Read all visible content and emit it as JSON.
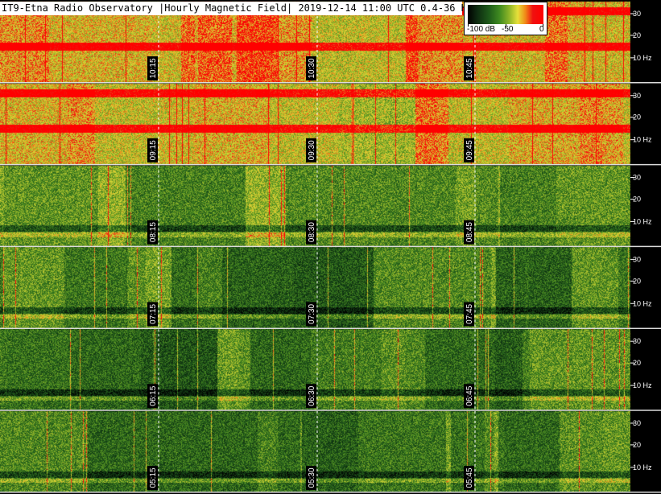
{
  "chart_data": {
    "type": "heatmap",
    "title": "IT9-Etna Radio Observatory |Hourly Magnetic Field| 2019-12-14 11:00 UTC 0.4-36 Hz",
    "colorbar": {
      "labels": [
        "-100 dB",
        "-50",
        "0"
      ],
      "range": [
        -100,
        0
      ],
      "colors": [
        "#000000",
        "#1e5a1a",
        "#3f8a20",
        "#8fb628",
        "#e6e03a",
        "#f08a18",
        "#ff0000"
      ]
    },
    "y_ticks": [
      "30",
      "20",
      "10 Hz"
    ],
    "rows": [
      {
        "time_labels": [
          "10:15",
          "10:30",
          "10:45"
        ],
        "intensity": 0.78
      },
      {
        "time_labels": [
          "09:15",
          "09:30",
          "09:45"
        ],
        "intensity": 0.72
      },
      {
        "time_labels": [
          "08:15",
          "08:30",
          "08:45"
        ],
        "intensity": 0.55
      },
      {
        "time_labels": [
          "07:15",
          "07:30",
          "07:45"
        ],
        "intensity": 0.42
      },
      {
        "time_labels": [
          "06:15",
          "06:30",
          "06:45"
        ],
        "intensity": 0.4
      },
      {
        "time_labels": [
          "05:15",
          "05:30",
          "05:45"
        ],
        "intensity": 0.45
      }
    ]
  }
}
